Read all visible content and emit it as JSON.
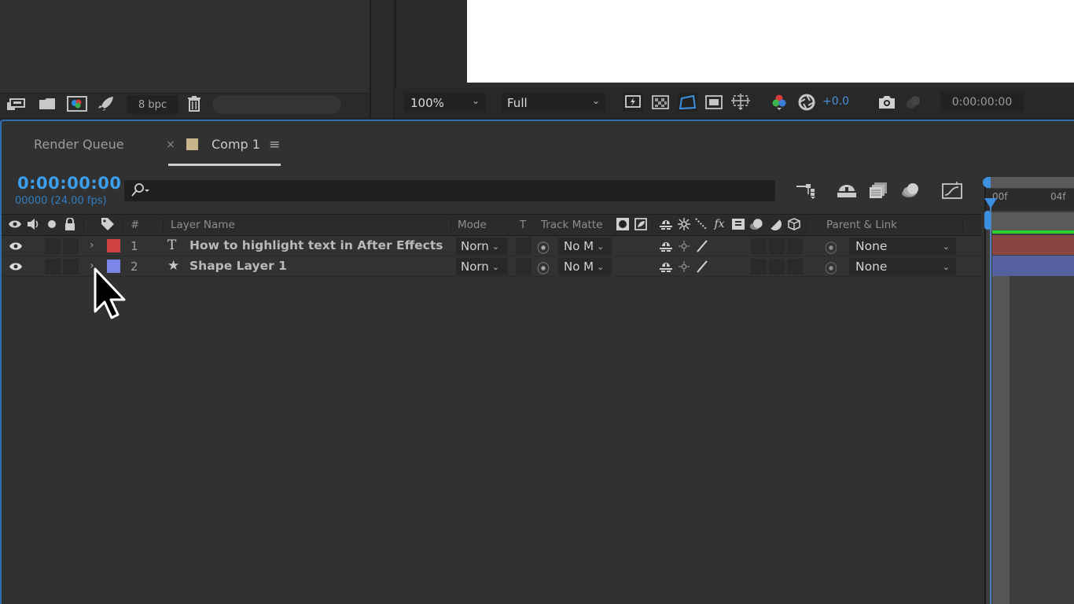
{
  "project_footer": {
    "bpc_label": "8 bpc",
    "icons": [
      "interpret-footage-icon",
      "new-folder-icon",
      "new-composition-icon",
      "render-rocket-icon",
      "trash-icon"
    ]
  },
  "viewer": {
    "zoom_value": "100%",
    "resolution_value": "Full",
    "exposure_value": "+0.0",
    "timecode": "0:00:00:00",
    "colors": {
      "exposure": "#4a8fdc",
      "canvas": "#ffffff"
    }
  },
  "tabs": [
    {
      "label": "Render Queue",
      "active": false
    },
    {
      "label": "Comp 1",
      "active": true,
      "color": "#c7b48a"
    }
  ],
  "timeline": {
    "current_time": "0:00:00:00",
    "frame_info": "00000 (24.00 fps)",
    "search_placeholder": "",
    "ruler_labels": [
      "00f",
      "04f"
    ],
    "accent_color": "#3b9ff0"
  },
  "columns": {
    "number": "#",
    "layer_name": "Layer Name",
    "mode": "Mode",
    "t": "T",
    "track_matte": "Track Matte",
    "parent_link": "Parent & Link"
  },
  "layers": [
    {
      "index": "1",
      "type_icon": "T",
      "type": "text",
      "name": "How to highlight text in After Effects",
      "label_color": "#d04040",
      "mode": "Norn",
      "track_matte": "No M",
      "parent": "None",
      "bar_color": "#8a4444"
    },
    {
      "index": "2",
      "type_icon": "★",
      "type": "shape",
      "name": "Shape Layer 1",
      "label_color": "#7b86e8",
      "mode": "Norn",
      "track_matte": "No M",
      "parent": "None",
      "bar_color": "#55609e"
    }
  ]
}
